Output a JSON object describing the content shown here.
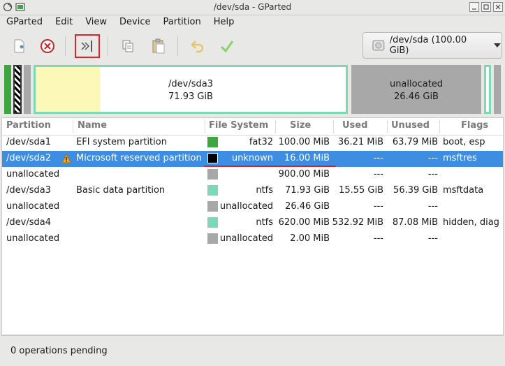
{
  "window": {
    "title": "/dev/sda - GParted"
  },
  "menu": [
    "GParted",
    "Edit",
    "View",
    "Device",
    "Partition",
    "Help"
  ],
  "toolbar": {
    "icons": [
      "new-partition-icon",
      "delete-partition-icon",
      "resize-move-icon",
      "copy-icon",
      "paste-icon",
      "undo-icon",
      "apply-icon"
    ]
  },
  "device": {
    "label": "/dev/sda (100.00 GiB)"
  },
  "diskmap": {
    "sda3": {
      "name": "/dev/sda3",
      "size": "71.93 GiB"
    },
    "unallocated": {
      "name": "unallocated",
      "size": "26.46 GiB"
    }
  },
  "columns": [
    "Partition",
    "Name",
    "File System",
    "Size",
    "Used",
    "Unused",
    "Flags"
  ],
  "rows": [
    {
      "partition": "/dev/sda1",
      "name": "EFI system partition",
      "fs": "fat32",
      "fs_color": "#3ea63e",
      "size": "100.00 MiB",
      "used": "36.21 MiB",
      "unused": "63.79 MiB",
      "flags": "boot, esp",
      "warn": false,
      "selected": false
    },
    {
      "partition": "/dev/sda2",
      "name": "Microsoft reserved partition",
      "fs": "unknown",
      "fs_color": "#000000",
      "size": "16.00 MiB",
      "used": "---",
      "unused": "---",
      "flags": "msftres",
      "warn": true,
      "selected": true
    },
    {
      "partition": "unallocated",
      "name": "",
      "fs": "",
      "fs_color": "#a8a8a8",
      "size": "900.00 MiB",
      "used": "---",
      "unused": "---",
      "flags": "",
      "warn": false,
      "selected": false
    },
    {
      "partition": "/dev/sda3",
      "name": "Basic data partition",
      "fs": "ntfs",
      "fs_color": "#7dd8b5",
      "size": "71.93 GiB",
      "used": "15.55 GiB",
      "unused": "56.39 GiB",
      "flags": "msftdata",
      "warn": false,
      "selected": false
    },
    {
      "partition": "unallocated",
      "name": "",
      "fs": "unallocated",
      "fs_color": "#a8a8a8",
      "size": "26.46 GiB",
      "used": "---",
      "unused": "---",
      "flags": "",
      "warn": false,
      "selected": false
    },
    {
      "partition": "/dev/sda4",
      "name": "",
      "fs": "ntfs",
      "fs_color": "#7dd8b5",
      "size": "620.00 MiB",
      "used": "532.92 MiB",
      "unused": "87.08 MiB",
      "flags": "hidden, diag",
      "warn": false,
      "selected": false
    },
    {
      "partition": "unallocated",
      "name": "",
      "fs": "unallocated",
      "fs_color": "#a8a8a8",
      "size": "2.00 MiB",
      "used": "---",
      "unused": "---",
      "flags": "",
      "warn": false,
      "selected": false
    }
  ],
  "status": {
    "text": "0 operations pending"
  },
  "colors": {
    "selection": "#3d8ee2",
    "highlight_box": "#d42a2a",
    "ntfs": "#7dd8b5",
    "fat32": "#3ea63e",
    "unallocated": "#a8a8a8"
  }
}
